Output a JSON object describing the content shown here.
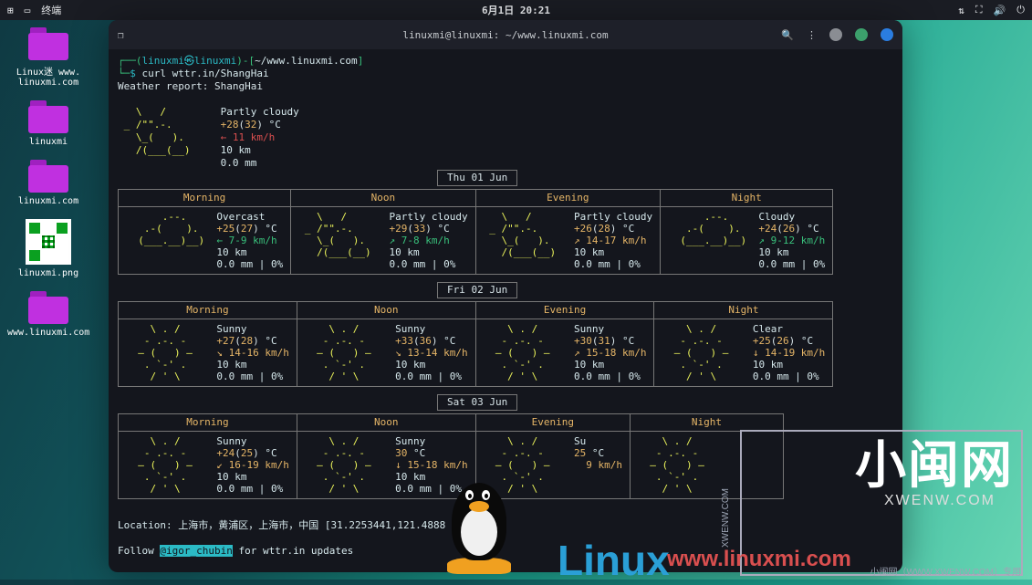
{
  "topbar": {
    "apps_icon": "⊞",
    "window_icon": "▭",
    "terminal_label": "终端",
    "datetime": "6月1日 20:21",
    "tray_net": "⇅",
    "tray_max": "⛶",
    "tray_vol": "🔊",
    "tray_power": "⏻"
  },
  "desktop": {
    "icons": [
      {
        "type": "folder",
        "label": "Linux迷 www.\nlinuxmi.com"
      },
      {
        "type": "folder",
        "label": "linuxmi"
      },
      {
        "type": "folder",
        "label": "linuxmi.com"
      },
      {
        "type": "qr",
        "label": "linuxmi.png"
      },
      {
        "type": "folder",
        "label": "www.linuxmi.com"
      }
    ]
  },
  "terminal": {
    "icon": "❐",
    "title": "linuxmi@linuxmi: ~/www.linuxmi.com",
    "search_icon": "🔍",
    "menu_icon": "⋮",
    "min_color": "#8a8d93",
    "max_color": "#3ca06c",
    "close_color": "#2a7de1",
    "prompt_user": "linuxmi㉿linuxmi",
    "prompt_path": "~/www.linuxmi.com",
    "command": "curl wttr.in/ShangHai",
    "report_line": "Weather report: ShangHai",
    "current": {
      "ascii": "   \\   /\n _ /\"\".-.\n   \\_(   ).\n   /(___(__)",
      "cond": "Partly cloudy",
      "temp": "+28",
      "temp2": "32",
      "unit": " °C",
      "wind": "← 11 km/h",
      "vis": "10 km",
      "precip": "0.0 mm"
    },
    "days": [
      {
        "date": "Thu 01 Jun",
        "cols": [
          "Morning",
          "Noon",
          "Evening",
          "Night"
        ],
        "cells": [
          {
            "ascii": "      .--.\n   .-(    ).\n  (___.__)__) ",
            "cond": "Overcast",
            "t1": "+25",
            "t2": "27",
            "wind": "← 7-9 km/h",
            "windc": "green",
            "vis": "10 km",
            "pr": "0.0 mm | 0%"
          },
          {
            "ascii": "   \\   /\n _ /\"\".-.\n   \\_(   ).\n   /(___(__)",
            "cond": "Partly cloudy",
            "t1": "+29",
            "t2": "33",
            "wind": "↗ 7-8 km/h",
            "windc": "green",
            "vis": "10 km",
            "pr": "0.0 mm | 0%"
          },
          {
            "ascii": "   \\   /\n _ /\"\".-.\n   \\_(   ).\n   /(___(__)",
            "cond": "Partly cloudy",
            "t1": "+26",
            "t2": "28",
            "wind": "↗ 14-17 km/h",
            "windc": "yellow",
            "vis": "10 km",
            "pr": "0.0 mm | 0%"
          },
          {
            "ascii": "      .--.\n   .-(    ).\n  (___.__)__) ",
            "cond": "Cloudy",
            "t1": "+24",
            "t2": "26",
            "wind": "↗ 9-12 km/h",
            "windc": "green",
            "vis": "10 km",
            "pr": "0.0 mm | 0%"
          }
        ]
      },
      {
        "date": "Fri 02 Jun",
        "cols": [
          "Morning",
          "Noon",
          "Evening",
          "Night"
        ],
        "cells": [
          {
            "ascii": "    \\ . /\n   - .-. -\n  ‒ (   ) ‒\n   . `-' .\n    / ' \\",
            "cond": "Sunny",
            "t1": "+27",
            "t2": "28",
            "wind": "↘ 14-16 km/h",
            "windc": "yellow",
            "vis": "10 km",
            "pr": "0.0 mm | 0%"
          },
          {
            "ascii": "    \\ . /\n   - .-. -\n  ‒ (   ) ‒\n   . `-' .\n    / ' \\",
            "cond": "Sunny",
            "t1": "+33",
            "t2": "36",
            "wind": "↘ 13-14 km/h",
            "windc": "yellow",
            "vis": "10 km",
            "pr": "0.0 mm | 0%"
          },
          {
            "ascii": "    \\ . /\n   - .-. -\n  ‒ (   ) ‒\n   . `-' .\n    / ' \\",
            "cond": "Sunny",
            "t1": "+30",
            "t2": "31",
            "wind": "↗ 15-18 km/h",
            "windc": "yellow",
            "vis": "10 km",
            "pr": "0.0 mm | 0%"
          },
          {
            "ascii": "    \\ . /\n   - .-. -\n  ‒ (   ) ‒\n   . `-' .\n    / ' \\",
            "cond": "Clear",
            "t1": "+25",
            "t2": "26",
            "wind": "↓ 14-19 km/h",
            "windc": "yellow",
            "vis": "10 km",
            "pr": "0.0 mm | 0%"
          }
        ]
      },
      {
        "date": "Sat 03 Jun",
        "cols": [
          "Morning",
          "Noon",
          "Evening",
          "Night"
        ],
        "cells": [
          {
            "ascii": "    \\ . /\n   - .-. -\n  ‒ (   ) ‒\n   . `-' .\n    / ' \\",
            "cond": "Sunny",
            "t1": "+24",
            "t2": "25",
            "wind": "↙ 16-19 km/h",
            "windc": "yellow",
            "vis": "10 km",
            "pr": "0.0 mm | 0%"
          },
          {
            "ascii": "    \\ . /\n   - .-. -\n  ‒ (   ) ‒\n   . `-' .\n    / ' \\",
            "cond": "Sunny",
            "t1": "30",
            "t2": "",
            "wind": "↓ 15-18 km/h",
            "windc": "yellow",
            "vis": "10 km",
            "pr": "0.0 mm | 0%"
          },
          {
            "ascii": "    \\ . /\n   - .-. -\n  ‒ (   ) ‒\n   . `-' .\n    / ' \\",
            "cond": "Su",
            "t1": "25",
            "t2": "",
            "wind": "  9 km/h",
            "windc": "yellow",
            "vis": "",
            "pr": ""
          },
          {
            "ascii": "    \\ . /\n   - .-. -\n  ‒ (   ) ‒\n   . `-' .\n    / ' \\",
            "cond": "",
            "t1": "",
            "t2": "",
            "wind": "",
            "windc": "yellow",
            "vis": "",
            "pr": ""
          }
        ]
      }
    ],
    "location": "Location: 上海市，黄浦区，上海市，中国 [31.2253441,121.4888",
    "follow_pre": "Follow ",
    "follow_hl": "@igor_chubin",
    "follow_post": " for wttr.in updates"
  },
  "overlay": {
    "big": "小闽网",
    "sub": "XWENW.COM",
    "linux": "Linux",
    "red": "www.linuxmi.com",
    "wm_side": "XWENW.COM",
    "wm_bottom": "小闽网（WWW.XWENW.COM）专用"
  }
}
